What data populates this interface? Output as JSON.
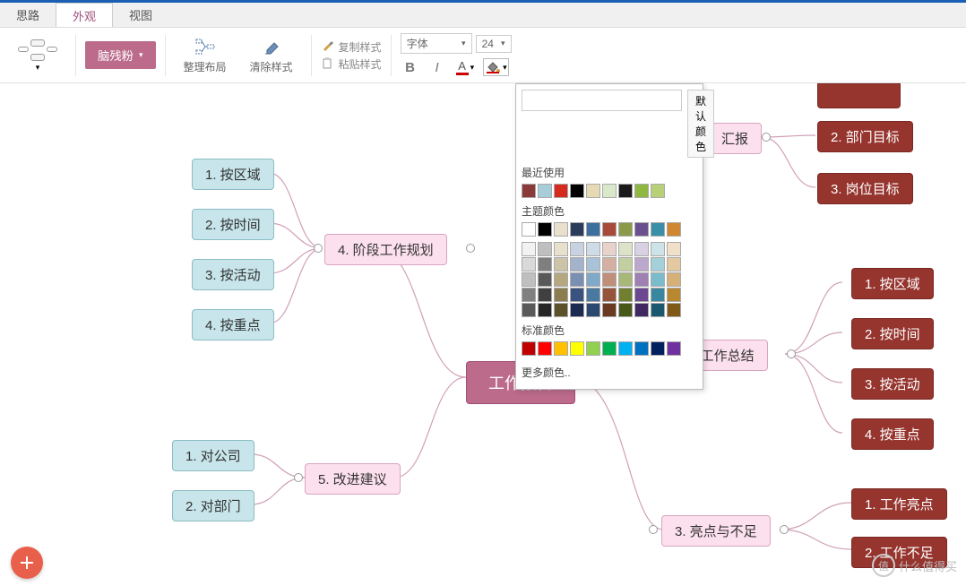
{
  "tabs": {
    "t1": "思路",
    "t2": "外观",
    "t3": "视图"
  },
  "toolbar": {
    "theme_btn": "脑残粉",
    "arrange": "整理布局",
    "clear_style": "清除样式",
    "copy_style": "复制样式",
    "paste_style": "粘贴样式",
    "font_label": "字体",
    "font_size": "24",
    "bold": "B",
    "italic": "I",
    "font_color": "A"
  },
  "color_popup": {
    "default_btn": "默认颜色",
    "recent_title": "最近使用",
    "recent": [
      "#8b3a3a",
      "#a6cdd8",
      "#d52b1e",
      "#000000",
      "#e8d9b5",
      "#d9e8c9",
      "#1a1a1a",
      "#8fb840",
      "#b8d078"
    ],
    "theme_title": "主题颜色",
    "theme_base": [
      "#ffffff",
      "#000000",
      "#e8e0cc",
      "#2a3b5c",
      "#3b6fa0",
      "#a84a3a",
      "#8a9a4a",
      "#6b508f",
      "#3a8fa8",
      "#d08830"
    ],
    "theme_tints": [
      [
        "#f2f2f2",
        "#bfbfbf",
        "#e6e0cc",
        "#c9d2e0",
        "#cfdce8",
        "#e8d2cc",
        "#dde3c9",
        "#d8d0e3",
        "#cce3e8",
        "#f0dfc9"
      ],
      [
        "#d9d9d9",
        "#7f7f7f",
        "#ccc4a8",
        "#a3b3cc",
        "#a8c2d8",
        "#d4b0a3",
        "#c2cfa0",
        "#bba8cc",
        "#a3d0d9",
        "#e3c8a0"
      ],
      [
        "#bfbfbf",
        "#595959",
        "#b3a880",
        "#7a90b3",
        "#80a8c8",
        "#c08f7a",
        "#a8b878",
        "#9f80b3",
        "#7abccc",
        "#d5b078"
      ],
      [
        "#808080",
        "#404040",
        "#8a7d50",
        "#3a5280",
        "#4978a0",
        "#96543a",
        "#708030",
        "#6b4890",
        "#3a88a0",
        "#b88830"
      ],
      [
        "#595959",
        "#262626",
        "#5c522a",
        "#1a2a50",
        "#2a4870",
        "#6b3820",
        "#485818",
        "#402860",
        "#1a5870",
        "#805818"
      ]
    ],
    "standard_title": "标准颜色",
    "standard": [
      "#c00000",
      "#ff0000",
      "#ffc000",
      "#ffff00",
      "#92d050",
      "#00b050",
      "#00b0f0",
      "#0070c0",
      "#002060",
      "#7030a0"
    ],
    "more": "更多颜色.."
  },
  "mindmap": {
    "center": "工作报告",
    "left_b1": "4. 阶段工作规划",
    "left_b1_children": [
      "1. 按区域",
      "2. 按时间",
      "3. 按活动",
      "4. 按重点"
    ],
    "left_b2": "5. 改进建议",
    "left_b2_children": [
      "1. 对公司",
      "2. 对部门"
    ],
    "right_b1": "汇报",
    "right_b1_children": [
      "2. 部门目标",
      "3. 岗位目标"
    ],
    "right_b2": "2. 阶段工作总结",
    "right_b2_children": [
      "1. 按区域",
      "2. 按时间",
      "3. 按活动",
      "4. 按重点"
    ],
    "right_b3": "3. 亮点与不足",
    "right_b3_children": [
      "1. 工作亮点",
      "2. 工作不足"
    ]
  },
  "watermark": "什么值得买",
  "wm_badge": "值"
}
